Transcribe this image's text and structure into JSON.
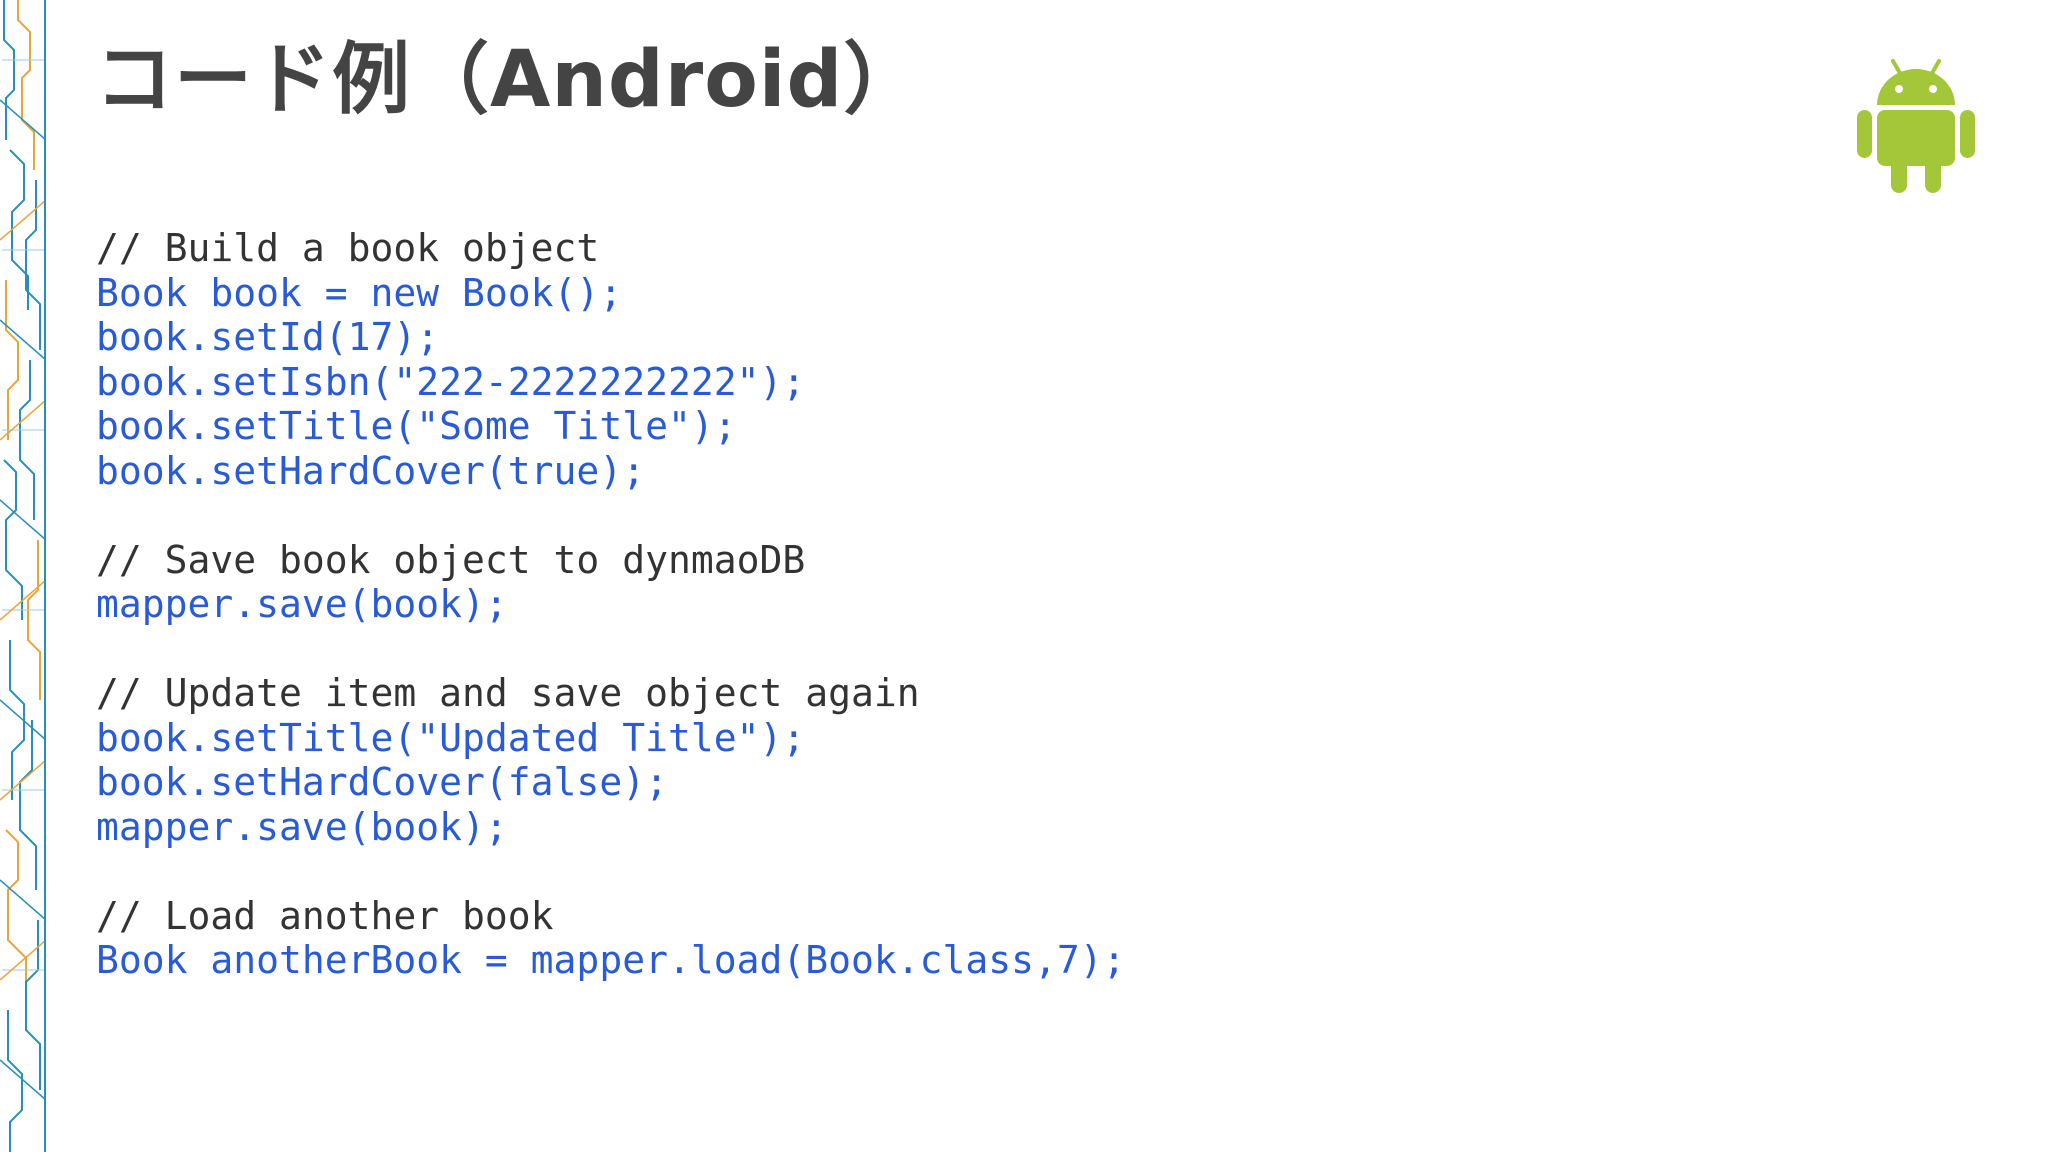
{
  "slide": {
    "title": "コード例（Android）",
    "logo": "android-robot-icon",
    "colors": {
      "title": "#444444",
      "comment": "#333333",
      "code": "#2a5bd7",
      "android_green": "#a4c639",
      "border_blue": "#2a8fb8",
      "border_orange": "#e8a63a"
    },
    "code_lines": [
      {
        "kind": "comment",
        "text": "// Build a book object"
      },
      {
        "kind": "code",
        "text": "Book book = new Book();"
      },
      {
        "kind": "code",
        "text": "book.setId(17);"
      },
      {
        "kind": "code",
        "text": "book.setIsbn(\"222-2222222222\");"
      },
      {
        "kind": "code",
        "text": "book.setTitle(\"Some Title\");"
      },
      {
        "kind": "code",
        "text": "book.setHardCover(true);"
      },
      {
        "kind": "blank",
        "text": ""
      },
      {
        "kind": "comment",
        "text": "// Save book object to dynmaoDB"
      },
      {
        "kind": "code",
        "text": "mapper.save(book);"
      },
      {
        "kind": "blank",
        "text": ""
      },
      {
        "kind": "comment",
        "text": "// Update item and save object again"
      },
      {
        "kind": "code",
        "text": "book.setTitle(\"Updated Title\");"
      },
      {
        "kind": "code",
        "text": "book.setHardCover(false);"
      },
      {
        "kind": "code",
        "text": "mapper.save(book);"
      },
      {
        "kind": "blank",
        "text": ""
      },
      {
        "kind": "comment",
        "text": "// Load another book"
      },
      {
        "kind": "code",
        "text": "Book anotherBook = mapper.load(Book.class,7);"
      }
    ]
  }
}
